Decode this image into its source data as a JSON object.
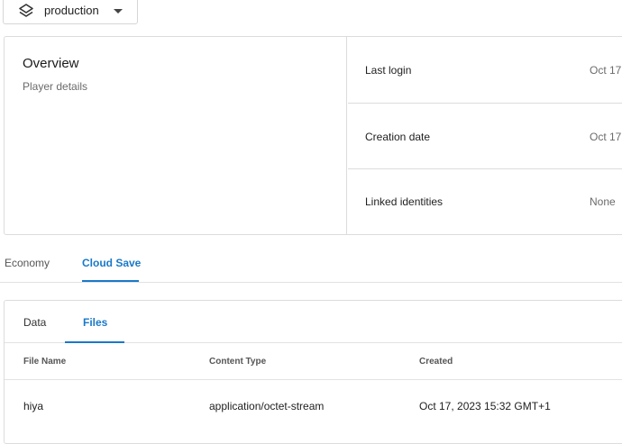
{
  "environment": {
    "label": "production",
    "icon": "layers-icon",
    "caret_icon": "caret-down-icon"
  },
  "overview": {
    "title": "Overview",
    "subtitle": "Player details",
    "rows": [
      {
        "label": "Last login",
        "value": "Oct 17,"
      },
      {
        "label": "Creation date",
        "value": "Oct 17,"
      },
      {
        "label": "Linked identities",
        "value": "None"
      }
    ]
  },
  "tabs": [
    {
      "label": "Economy",
      "active": false
    },
    {
      "label": "Cloud Save",
      "active": true
    }
  ],
  "cloud_save": {
    "tabs": [
      {
        "label": "Data",
        "active": false
      },
      {
        "label": "Files",
        "active": true
      }
    ],
    "table": {
      "columns": [
        "File Name",
        "Content Type",
        "Created"
      ],
      "rows": [
        [
          "hiya",
          "application/octet-stream",
          "Oct 17, 2023 15:32 GMT+1"
        ]
      ]
    }
  },
  "colors": {
    "accent": "#1a79c8",
    "border": "#dcdcdc",
    "muted_text": "#6b6b6b"
  }
}
